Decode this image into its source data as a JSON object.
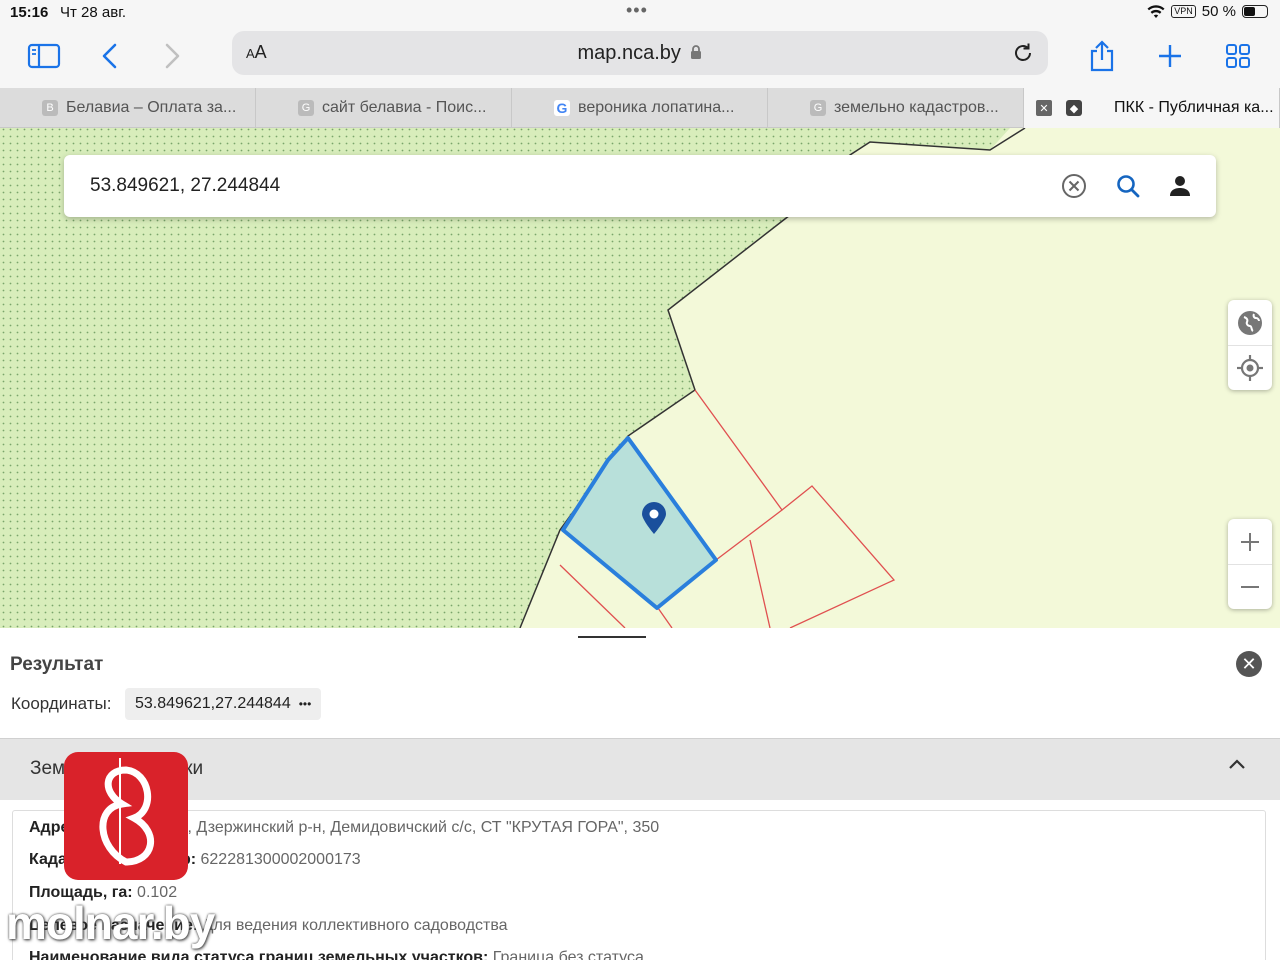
{
  "status": {
    "time": "15:16",
    "date": "Чт 28 авг.",
    "vpn": "VPN",
    "battery": "50 %",
    "battery_level": 0.5
  },
  "toolbar": {
    "aa": "AA",
    "url": "map.nca.by"
  },
  "tabs": [
    {
      "favicon": "B",
      "label": "Белавиа – Оплата за..."
    },
    {
      "favicon": "G",
      "label": "сайт белавиа - Поис..."
    },
    {
      "favicon": "G",
      "label": "вероника лопатина..."
    },
    {
      "favicon": "G",
      "label": "земельно кадастров..."
    },
    {
      "favicon": "",
      "label": "ПКК - Публичная ка..."
    }
  ],
  "search": {
    "query": "53.849621, 27.244844"
  },
  "result": {
    "title": "Результат",
    "coords_label": "Координаты:",
    "coords_value": "53.849621,27.244844",
    "more": "•••",
    "section_title": "Земельные участки",
    "fields": [
      {
        "label": "Адрес:",
        "value": "Минская обл., Дзержинский р-н, Демидовичский с/с, СТ \"КРУТАЯ ГОРА\", 350"
      },
      {
        "label": "Кадастровый номер:",
        "value": "622281300002000173"
      },
      {
        "label": "Площадь, га:",
        "value": "0.102"
      },
      {
        "label": "Целевое назначение:",
        "value": "Для ведения коллективного садоводства"
      },
      {
        "label": "Наименование вида статуса границ земельных участков:",
        "value": "Граница без статуса"
      }
    ]
  },
  "watermark": {
    "text": "molnar.by"
  },
  "colors": {
    "accent": "#1a73e8",
    "parcel_fill": "#b8e0da",
    "parcel_stroke": "#2a7fdc",
    "boundary": "#e05050",
    "forest": "#d6ecb6",
    "pin": "#1a4f9c"
  }
}
